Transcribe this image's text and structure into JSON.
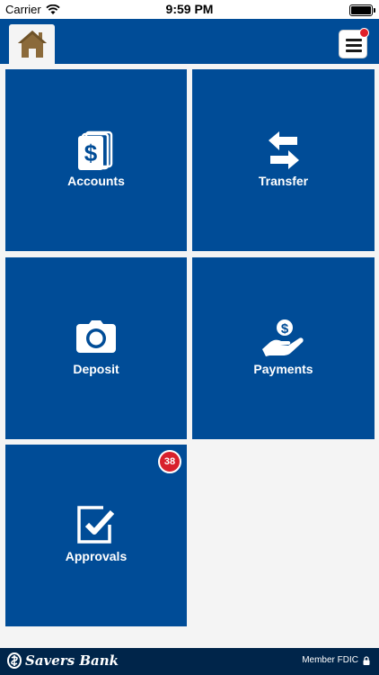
{
  "status_bar": {
    "carrier": "Carrier",
    "time": "9:59 PM",
    "wifi_icon": "wifi-icon",
    "battery_icon": "battery-icon"
  },
  "header": {
    "home_icon": "home-icon",
    "menu_icon": "hamburger-menu-icon",
    "menu_notification": true
  },
  "tiles": [
    {
      "label": "Accounts",
      "icon": "accounts-dollar-icon"
    },
    {
      "label": "Transfer",
      "icon": "transfer-arrows-icon"
    },
    {
      "label": "Deposit",
      "icon": "camera-icon"
    },
    {
      "label": "Payments",
      "icon": "payment-hand-icon"
    },
    {
      "label": "Approvals",
      "icon": "approvals-check-icon",
      "badge": "38"
    }
  ],
  "footer": {
    "bank_name": "Savers Bank",
    "member": "Member FDIC",
    "lock_icon": "lock-icon"
  },
  "colors": {
    "tile_blue": "#004c97",
    "footer_navy": "#00254a",
    "badge_red": "#d8202c",
    "home_brown": "#8b6a3a"
  }
}
